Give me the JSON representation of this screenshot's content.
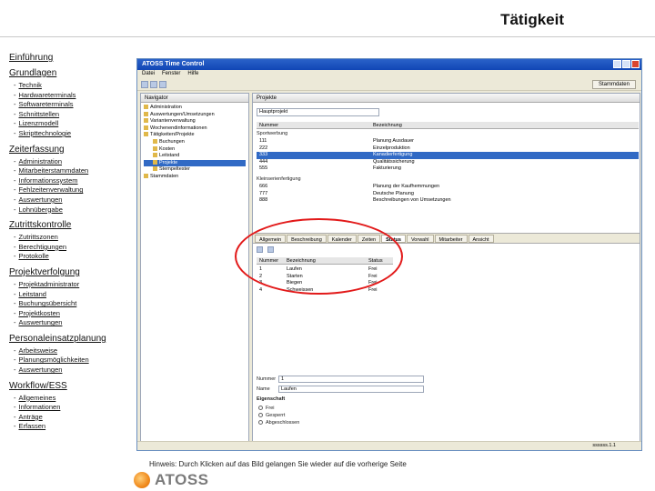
{
  "page": {
    "title": "Tätigkeit",
    "hint": "Hinweis: Durch Klicken auf das Bild gelangen Sie wieder auf die vorherige Seite",
    "logo_text": "ATOSS",
    "brand_color": "#f08a1c"
  },
  "nav": {
    "intro": "Einführung",
    "sections": [
      {
        "heading": "Grundlagen",
        "items": [
          "Technik",
          "Hardwareterminals",
          "Softwareterminals",
          "Schnittstellen",
          "Lizenzmodell",
          "Skripttechnologie"
        ]
      },
      {
        "heading": "Zeiterfassung",
        "items": [
          "Administration",
          "Mitarbeiterstammdaten",
          "Informationssystem",
          "Fehlzeitenverwaltung",
          "Auswertungen",
          "Lohnübergabe"
        ]
      },
      {
        "heading": "Zutrittskontrolle",
        "items": [
          "Zutrittszonen",
          "Berechtigungen",
          "Protokolle"
        ]
      },
      {
        "heading": "Projektverfolgung",
        "items": [
          "Projektadministrator",
          "Leitstand",
          "Buchungsübersicht",
          "Projektkosten",
          "Auswertungen"
        ]
      },
      {
        "heading": "Personaleinsatzplanung",
        "items": [
          "Arbeitsweise",
          "Planungsmöglichkeiten",
          "Auswertungen"
        ]
      },
      {
        "heading": "Workflow/ESS",
        "items": [
          "Allgemeines",
          "Informationen",
          "Anträge",
          "Erfassen"
        ]
      }
    ]
  },
  "app": {
    "window_title": "ATOSS Time Control",
    "menu": [
      "Datei",
      "Fenster",
      "Hilfe"
    ],
    "perspective": "Stammdaten",
    "navigator_tab": "Navigator",
    "navigator_tree": [
      "Administration",
      "Auswertungen/Umsetzungen",
      "Variantenverwaltung",
      "Wochenendinformationen",
      "Tätigkeiten/Projekte",
      "Buchungen",
      "Kosten",
      "Leitstand",
      "Projekte",
      "Stempeltester",
      "Stammdaten"
    ],
    "editor_tab": "Projekte",
    "editor_field_label": "Hauptprojekt",
    "columns": [
      "Nummer",
      "Bezeichnung"
    ],
    "group1": "Sportwerbung",
    "rows1": [
      {
        "nr": "111",
        "desc": "Planung Ausdauer"
      },
      {
        "nr": "222",
        "desc": "Einzelproduktion"
      },
      {
        "nr": "333",
        "desc": "Kanadierfertigung"
      },
      {
        "nr": "444",
        "desc": "Qualitätssicherung"
      },
      {
        "nr": "555",
        "desc": "Fakturierung"
      }
    ],
    "group2": "Kleinserienfertigung",
    "rows2": [
      {
        "nr": "666",
        "desc": "Planung der Kaufhemmungen"
      },
      {
        "nr": "777",
        "desc": "Deutsche Planung"
      },
      {
        "nr": "888",
        "desc": "Beschreibungen von Umsetzungen"
      }
    ],
    "detail_tabs": [
      "Allgemein",
      "Beschreibung",
      "Kalender",
      "Zeiten",
      "Status",
      "Vorwahl",
      "Mitarbeiter",
      "Ansicht"
    ],
    "status_columns": [
      "Nummer",
      "Bezeichnung",
      "Status"
    ],
    "status_rows": [
      {
        "nr": "1",
        "desc": "Laufen",
        "status": "Frei"
      },
      {
        "nr": "2",
        "desc": "Starten",
        "status": "Frei"
      },
      {
        "nr": "3",
        "desc": "Biegen",
        "status": "Frei"
      },
      {
        "nr": "4",
        "desc": "Schweissen",
        "status": "Frei"
      }
    ],
    "form": {
      "nummer_label": "Nummer",
      "nummer_value": "1",
      "name_label": "Name",
      "name_value": "Laufen",
      "group_title": "Eigenschaft",
      "options": [
        "Frei",
        "Gesperrt",
        "Abgeschlossen"
      ]
    },
    "status_text": "ssssss.1.1"
  }
}
